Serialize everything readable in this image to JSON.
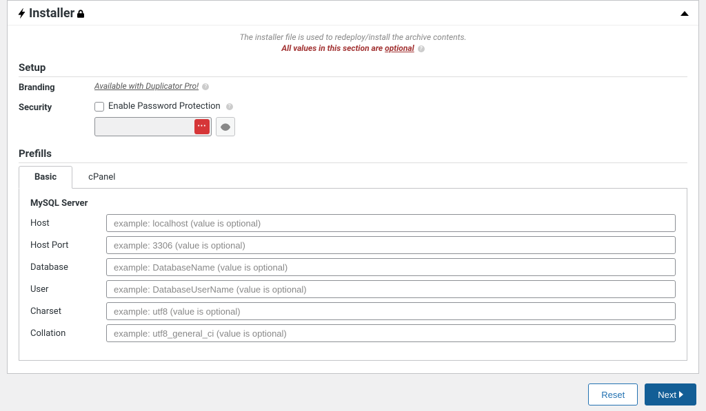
{
  "header": {
    "title": "Installer"
  },
  "info": {
    "line1": "The installer file is used to redeploy/install the archive contents.",
    "line2_prefix": "All values in this section are ",
    "line2_emphasis": "optional"
  },
  "setup": {
    "heading": "Setup",
    "branding_label": "Branding",
    "branding_value": "Available with Duplicator Pro!",
    "security_label": "Security",
    "security_checkbox_label": "Enable Password Protection",
    "password_value": ""
  },
  "prefills": {
    "heading": "Prefills",
    "tabs": {
      "basic": "Basic",
      "cpanel": "cPanel"
    },
    "mysql_heading": "MySQL Server",
    "fields": {
      "host": {
        "label": "Host",
        "placeholder": "example: localhost (value is optional)"
      },
      "host_port": {
        "label": "Host Port",
        "placeholder": "example: 3306 (value is optional)"
      },
      "database": {
        "label": "Database",
        "placeholder": "example: DatabaseName (value is optional)"
      },
      "user": {
        "label": "User",
        "placeholder": "example: DatabaseUserName (value is optional)"
      },
      "charset": {
        "label": "Charset",
        "placeholder": "example: utf8 (value is optional)"
      },
      "collation": {
        "label": "Collation",
        "placeholder": "example: utf8_general_ci (value is optional)"
      }
    }
  },
  "footer": {
    "reset": "Reset",
    "next": "Next"
  }
}
